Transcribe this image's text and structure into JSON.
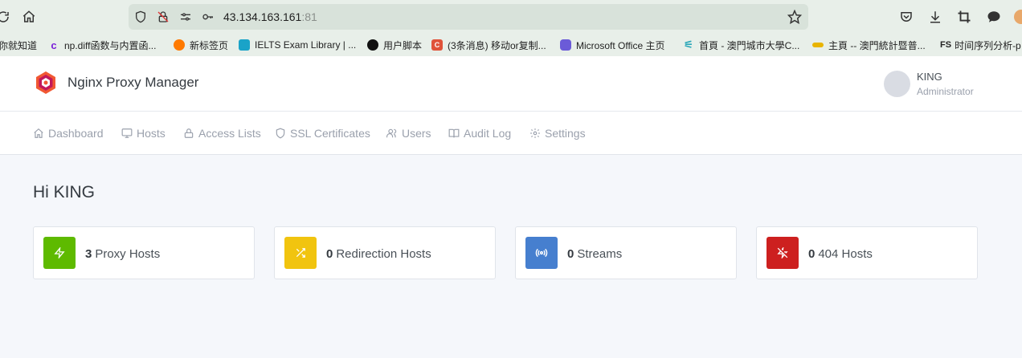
{
  "browser": {
    "url_host": "43.134.163.161",
    "url_port": ":81",
    "bookmarks": [
      {
        "label": "你就知道",
        "color": "#888888",
        "icon": "blank-icon"
      },
      {
        "label": "np.diff函数与内置函...",
        "color": "#7a1fd8",
        "icon": "c-letter-icon"
      },
      {
        "label": "新标签页",
        "color": "#ff7a00",
        "icon": "firefox-icon"
      },
      {
        "label": "IELTS Exam Library | ...",
        "color": "#1aa3c8",
        "icon": "ielts-icon"
      },
      {
        "label": "用户脚本",
        "color": "#111111",
        "icon": "script-icon"
      },
      {
        "label": "(3条消息) 移动or复制...",
        "color": "#e0533a",
        "icon": "c-letter-icon"
      },
      {
        "label": "Microsoft Office 主页",
        "color": "#6b5bd8",
        "icon": "office-icon"
      },
      {
        "label": "首頁 - 澳門城市大學C...",
        "color": "#2aa7b8",
        "icon": "university-icon"
      },
      {
        "label": "主頁 -- 澳門統計暨普...",
        "color": "#e8b400",
        "icon": "stats-icon"
      },
      {
        "label": "时间序列分析-p",
        "color": "#222222",
        "icon": "fs-icon"
      }
    ]
  },
  "app": {
    "name": "Nginx Proxy Manager",
    "user_name": "KING",
    "user_role": "Administrator"
  },
  "nav": [
    {
      "label": "Dashboard",
      "icon": "home-icon"
    },
    {
      "label": "Hosts",
      "icon": "monitor-icon"
    },
    {
      "label": "Access Lists",
      "icon": "lock-icon"
    },
    {
      "label": "SSL Certificates",
      "icon": "shield-icon"
    },
    {
      "label": "Users",
      "icon": "users-icon"
    },
    {
      "label": "Audit Log",
      "icon": "book-icon"
    },
    {
      "label": "Settings",
      "icon": "gear-icon"
    }
  ],
  "greeting": "Hi KING",
  "cards": [
    {
      "count": "3",
      "label": "Proxy Hosts",
      "color": "#5eba00",
      "icon": "zap-icon"
    },
    {
      "count": "0",
      "label": "Redirection Hosts",
      "color": "#f1c40f",
      "icon": "shuffle-icon"
    },
    {
      "count": "0",
      "label": "Streams",
      "color": "#467fcf",
      "icon": "radio-icon"
    },
    {
      "count": "0",
      "label": "404 Hosts",
      "color": "#cd201f",
      "icon": "zap-off-icon"
    }
  ]
}
